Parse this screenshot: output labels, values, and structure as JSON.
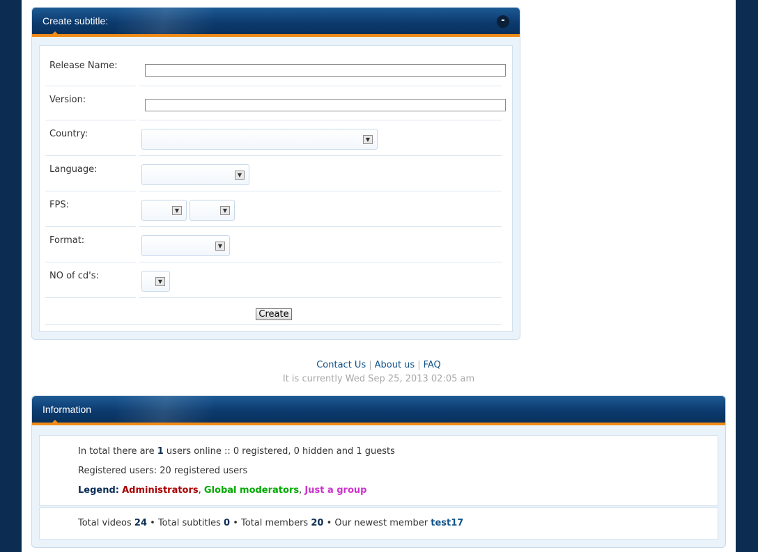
{
  "create_panel": {
    "title": "Create subtitle:",
    "collapse_label": "-",
    "fields": {
      "release_name_label": "Release Name:",
      "release_name_value": "",
      "version_label": "Version:",
      "version_value": "",
      "country_label": "Country:",
      "language_label": "Language:",
      "fps_label": "FPS:",
      "format_label": "Format:",
      "cds_label": "NO of cd's:"
    },
    "create_button": "Create"
  },
  "footer": {
    "links": [
      "Contact Us",
      "About us",
      "FAQ"
    ],
    "separator": "|",
    "current_time": "It is currently Wed Sep 25, 2013 02:05 am"
  },
  "info_panel": {
    "title": "Information",
    "online_prefix": "In total there are ",
    "online_count": "1",
    "online_suffix": " users online :: 0 registered, 0 hidden and 1 guests",
    "registered_users": "Registered users: 20 registered users",
    "legend_label": "Legend:",
    "legend_groups": [
      "Administrators",
      "Global moderators",
      "Just a group"
    ],
    "legend_colors": {
      "admin": "#aa0000",
      "gmod": "#00aa00",
      "group": "#cc33cc"
    },
    "stats": {
      "videos_label": "Total videos ",
      "videos": "24",
      "subtitles_label": " • Total subtitles ",
      "subtitles": "0",
      "members_label": " • Total members ",
      "members": "20",
      "newest_label": " • Our newest member ",
      "newest": "test17"
    }
  },
  "colors": {
    "page_background": "#0d2c52",
    "header_accent": "#f08b17",
    "link": "#105289"
  }
}
